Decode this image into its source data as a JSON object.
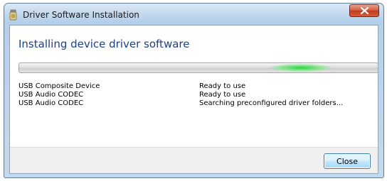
{
  "window": {
    "title": "Driver Software Installation",
    "title_icon": "usb-drive-icon",
    "close_icon": "close-icon"
  },
  "main": {
    "heading": "Installing device driver software",
    "progress": {
      "state": "indeterminate"
    },
    "devices": [
      {
        "name": "USB Composite Device",
        "status": "Ready to use"
      },
      {
        "name": "USB Audio CODEC",
        "status": "Ready to use"
      },
      {
        "name": "USB Audio CODEC",
        "status": "Searching preconfigured driver folders..."
      }
    ]
  },
  "footer": {
    "close_label": "Close"
  },
  "colors": {
    "heading": "#1e3f8a",
    "progress_glow": "#29d63c",
    "titlebar_close": "#c03a1f",
    "button_border": "#3c7fb1"
  }
}
